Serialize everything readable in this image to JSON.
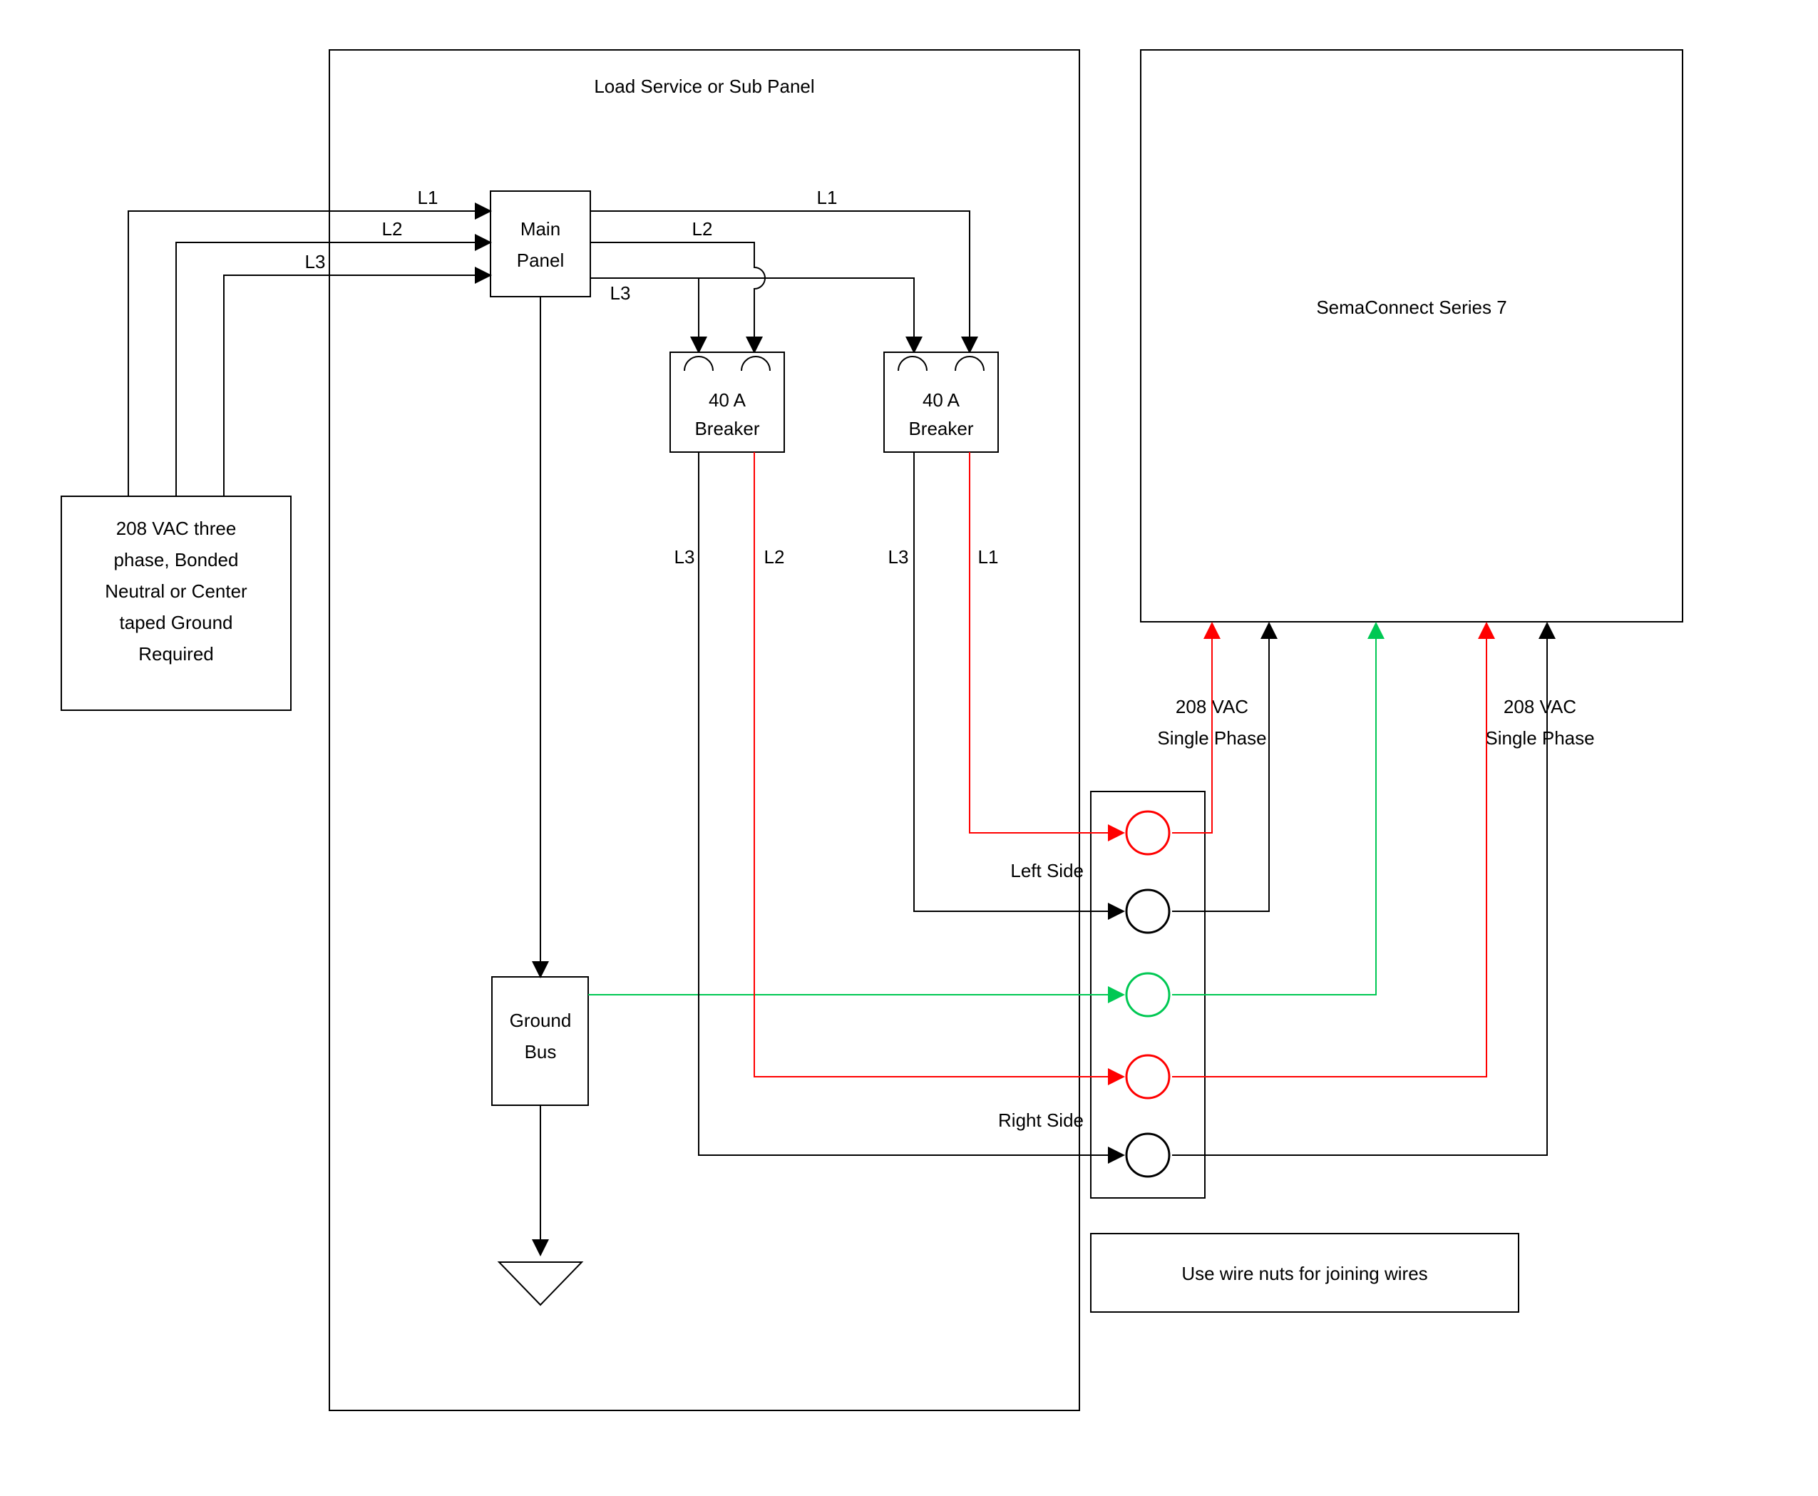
{
  "panel": {
    "title": "Load Service or Sub Panel"
  },
  "source": {
    "line1": "208 VAC three",
    "line2": "phase, Bonded",
    "line3": "Neutral or Center",
    "line4": "taped Ground",
    "line5": "Required"
  },
  "main_panel": {
    "line1": "Main",
    "line2": "Panel"
  },
  "breaker1": {
    "line1": "40 A",
    "line2": "Breaker"
  },
  "breaker2": {
    "line1": "40 A",
    "line2": "Breaker"
  },
  "ground_bus": {
    "line1": "Ground",
    "line2": "Bus"
  },
  "seriess7": {
    "label": "SemaConnect Series 7"
  },
  "phase_left": {
    "line1": "208 VAC",
    "line2": "Single Phase"
  },
  "phase_right": {
    "line1": "208 VAC",
    "line2": "Single Phase"
  },
  "sides": {
    "left": "Left Side",
    "right": "Right Side"
  },
  "note": {
    "text": "Use wire nuts for joining wires"
  },
  "conductors": {
    "l1": "L1",
    "l2": "L2",
    "l3": "L3",
    "b1_l3": "L3",
    "b1_l2": "L2",
    "b2_l3": "L3",
    "b2_l1": "L1"
  }
}
